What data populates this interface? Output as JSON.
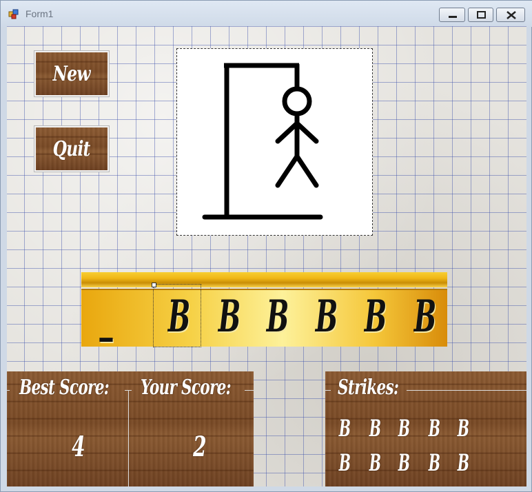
{
  "window": {
    "title": "Form1"
  },
  "buttons": {
    "new_label": "New",
    "quit_label": "Quit"
  },
  "word": {
    "slots": [
      "_",
      "B",
      "B",
      "B",
      "B",
      "B",
      "B"
    ]
  },
  "scores": {
    "best_label": "Best Score:",
    "best_value": "4",
    "your_label": "Your Score:",
    "your_value": "2"
  },
  "strikes": {
    "label": "Strikes:",
    "row1": [
      "B",
      "B",
      "B",
      "B",
      "B"
    ],
    "row2": [
      "B",
      "B",
      "B",
      "B",
      "B"
    ]
  },
  "colors": {
    "wood": "#7a4a25",
    "gold": "#f5c73a",
    "grid": "#3c50aa"
  },
  "icons": {
    "app": "app-icon",
    "minimize": "minimize-icon",
    "maximize": "maximize-icon",
    "close": "close-icon"
  }
}
